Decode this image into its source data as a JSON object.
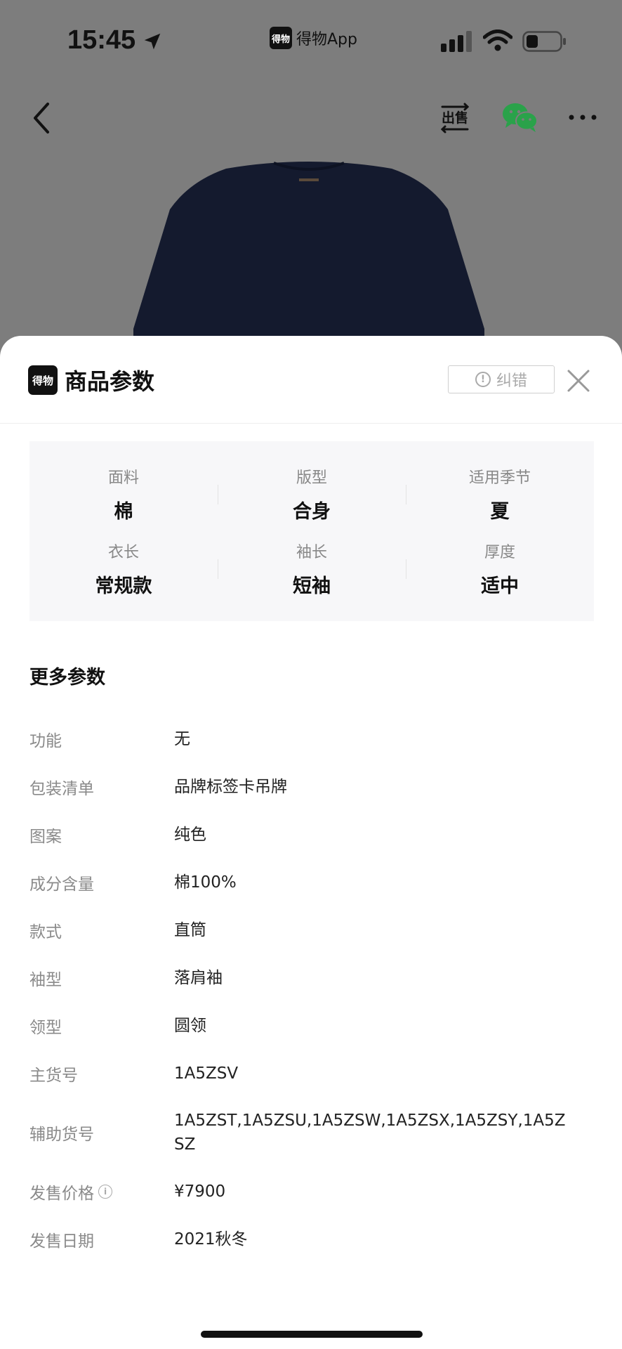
{
  "status_bar": {
    "time": "15:45",
    "app_name": "得物App",
    "app_logo_text": "得物"
  },
  "nav": {
    "icons": [
      "back-icon",
      "sell-icon",
      "wechat-icon",
      "more-icon"
    ],
    "sell_icon_text": "出售"
  },
  "sheet": {
    "logo_text": "得物",
    "title": "商品参数",
    "correct_label": "纠错",
    "key_params": [
      {
        "label": "面料",
        "value": "棉"
      },
      {
        "label": "版型",
        "value": "合身"
      },
      {
        "label": "适用季节",
        "value": "夏"
      },
      {
        "label": "衣长",
        "value": "常规款"
      },
      {
        "label": "袖长",
        "value": "短袖"
      },
      {
        "label": "厚度",
        "value": "适中"
      }
    ],
    "more_title": "更多参数",
    "params": [
      {
        "label": "功能",
        "value": "无"
      },
      {
        "label": "包装清单",
        "value": "品牌标签卡吊牌"
      },
      {
        "label": "图案",
        "value": "纯色"
      },
      {
        "label": "成分含量",
        "value": "棉100%"
      },
      {
        "label": "款式",
        "value": "直筒"
      },
      {
        "label": "袖型",
        "value": "落肩袖"
      },
      {
        "label": "领型",
        "value": "圆领"
      },
      {
        "label": "主货号",
        "value": "1A5ZSV"
      },
      {
        "label": "辅助货号",
        "value": "1A5ZST,1A5ZSU,1A5ZSW,1A5ZSX,1A5ZSY,1A5ZSZ"
      },
      {
        "label": "发售价格",
        "value": "¥7900"
      },
      {
        "label": "发售日期",
        "value": "2021秋冬"
      }
    ]
  },
  "colors": {
    "overlay": "#7d7d7d",
    "product": "#141a2e",
    "wechat_green": "#2aa24a"
  }
}
